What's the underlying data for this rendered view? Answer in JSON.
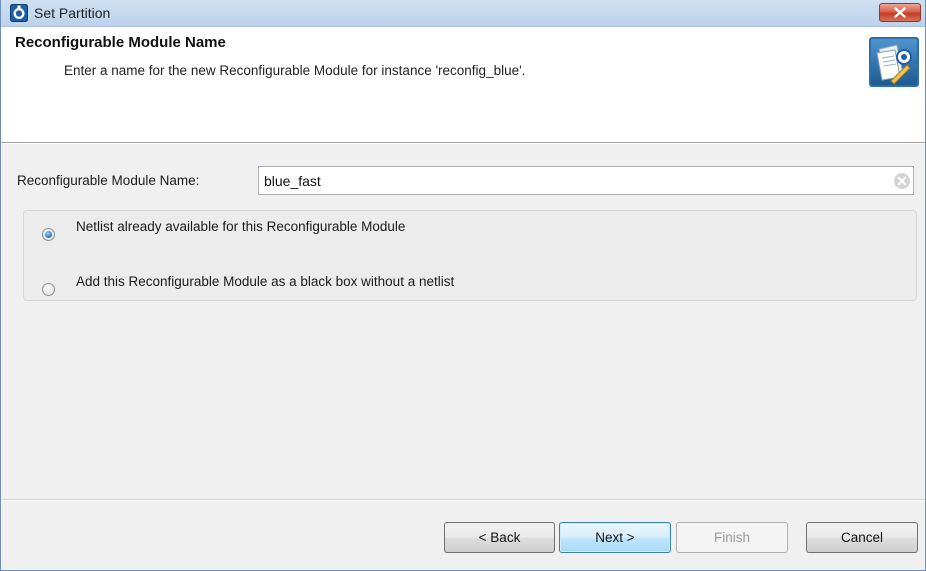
{
  "window": {
    "title": "Set Partition",
    "close_tooltip": "Close"
  },
  "banner": {
    "title": "Reconfigurable Module Name",
    "description": "Enter a name for the new Reconfigurable Module for instance 'reconfig_blue'."
  },
  "form": {
    "name_label": "Reconfigurable Module Name:",
    "name_value": "blue_fast"
  },
  "options": {
    "netlist_label": "Netlist already available for this Reconfigurable Module",
    "netlist_selected": true,
    "blackbox_label": "Add this Reconfigurable Module as a black box without a netlist",
    "blackbox_selected": false
  },
  "buttons": {
    "back": "< Back",
    "next": "Next >",
    "finish": "Finish",
    "cancel": "Cancel"
  },
  "colors": {
    "titlebar": "#bcd2eb",
    "close": "#c43b22",
    "radio_selected": "#2a7fc4",
    "next_button_border": "#3c7fb1"
  }
}
